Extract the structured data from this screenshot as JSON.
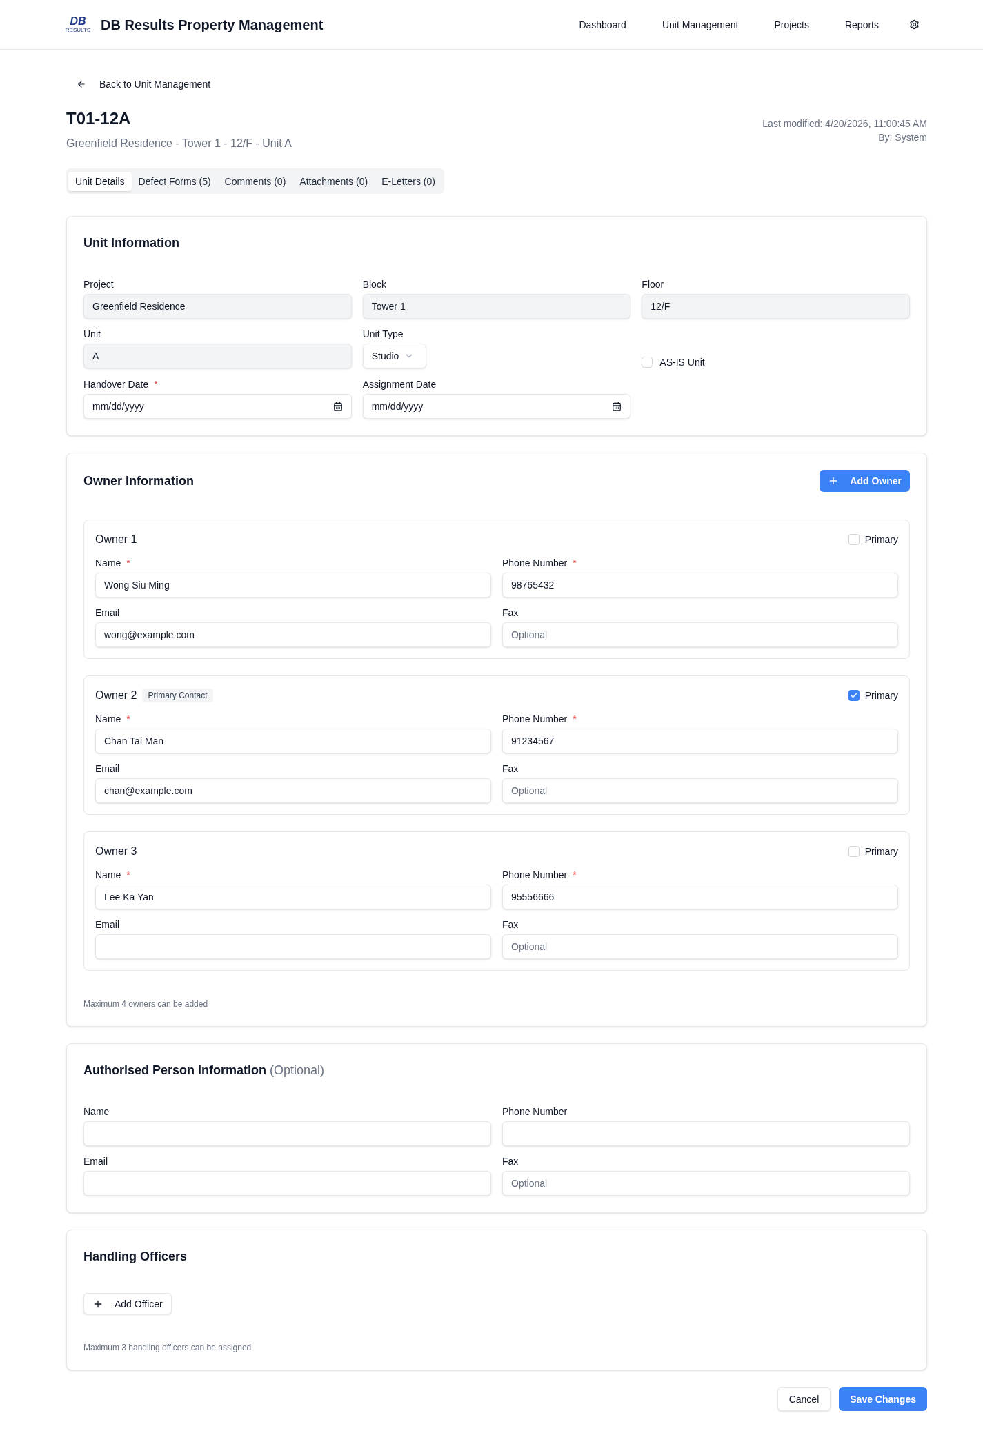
{
  "header": {
    "logo": {
      "mark": "DB",
      "caption": "RESULTS"
    },
    "title": "DB Results Property Management",
    "nav": [
      {
        "label": "Dashboard"
      },
      {
        "label": "Unit Management"
      },
      {
        "label": "Projects"
      },
      {
        "label": "Reports"
      }
    ]
  },
  "back_link": "Back to Unit Management",
  "unit": {
    "code": "T01-12A",
    "subtitle": "Greenfield Residence - Tower 1 - 12/F - Unit A",
    "last_modified": "Last modified: 4/20/2026, 11:00:45 AM",
    "modified_by": "By: System"
  },
  "tabs": [
    {
      "label": "Unit Details",
      "selected": true
    },
    {
      "label": "Defect Forms (5)",
      "selected": false
    },
    {
      "label": "Comments (0)",
      "selected": false
    },
    {
      "label": "Attachments (0)",
      "selected": false
    },
    {
      "label": "E-Letters (0)",
      "selected": false
    }
  ],
  "unit_information": {
    "title": "Unit Information",
    "fields": [
      {
        "kind": "text",
        "label": "Project",
        "value": "Greenfield Residence",
        "readonly": true
      },
      {
        "kind": "text",
        "label": "Block",
        "value": "Tower 1",
        "readonly": true
      },
      {
        "kind": "text",
        "label": "Floor",
        "value": "12/F",
        "readonly": true
      },
      {
        "kind": "text",
        "label": "Unit",
        "value": "A",
        "readonly": true
      },
      {
        "kind": "select",
        "label": "Unit Type",
        "value": "Studio"
      },
      {
        "kind": "checkbox",
        "label": "AS-IS Unit",
        "checked": false
      },
      {
        "kind": "date",
        "label": "Handover Date",
        "required_mark": "*",
        "placeholder": "mm/dd/yyyy"
      },
      {
        "kind": "date",
        "label": "Assignment Date",
        "placeholder": "mm/dd/yyyy"
      }
    ]
  },
  "owner_information": {
    "title": "Owner Information",
    "add_button": "Add Owner",
    "owners": [
      {
        "title": "Owner 1",
        "primary": false,
        "primary_label": "Primary",
        "fields": [
          {
            "label": "Name",
            "required_mark": "*",
            "value": "Wong Siu Ming"
          },
          {
            "label": "Phone Number",
            "required_mark": "*",
            "value": "98765432"
          },
          {
            "label": "Email",
            "value": "wong@example.com"
          },
          {
            "label": "Fax",
            "placeholder": "Optional"
          }
        ]
      },
      {
        "title": "Owner 2",
        "badge": "Primary Contact",
        "primary": true,
        "primary_label": "Primary",
        "fields": [
          {
            "label": "Name",
            "required_mark": "*",
            "value": "Chan Tai Man"
          },
          {
            "label": "Phone Number",
            "required_mark": "*",
            "value": "91234567"
          },
          {
            "label": "Email",
            "value": "chan@example.com"
          },
          {
            "label": "Fax",
            "placeholder": "Optional"
          }
        ]
      },
      {
        "title": "Owner 3",
        "primary": false,
        "primary_label": "Primary",
        "fields": [
          {
            "label": "Name",
            "required_mark": "*",
            "value": "Lee Ka Yan"
          },
          {
            "label": "Phone Number",
            "required_mark": "*",
            "value": "95556666"
          },
          {
            "label": "Email"
          },
          {
            "label": "Fax",
            "placeholder": "Optional"
          }
        ]
      }
    ],
    "note": "Maximum 4 owners can be added"
  },
  "authorised_person": {
    "title": "Authorised Person Information",
    "title_note": "(Optional)",
    "fields": [
      {
        "label": "Name"
      },
      {
        "label": "Phone Number"
      },
      {
        "label": "Email"
      },
      {
        "label": "Fax",
        "placeholder": "Optional"
      }
    ]
  },
  "handling_officers": {
    "title": "Handling Officers",
    "add_button": "Add Officer",
    "note": "Maximum 3 handling officers can be assigned"
  },
  "actions": [
    {
      "kind": "secondary",
      "label": "Cancel"
    },
    {
      "kind": "primary",
      "label": "Save Changes"
    }
  ]
}
